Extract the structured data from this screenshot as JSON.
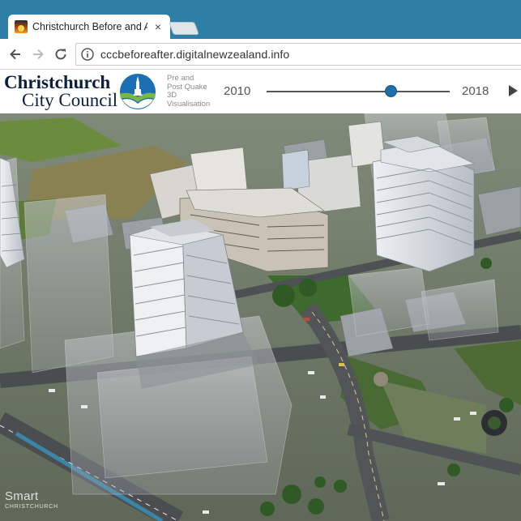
{
  "browser": {
    "tab": {
      "title": "Christchurch Before and Af",
      "close_glyph": "×"
    },
    "nav": {
      "back_icon": "arrow-left-icon",
      "forward_icon": "arrow-right-icon",
      "reload_icon": "reload-icon"
    },
    "address": {
      "url": "cccbeforeafter.digitalnewzealand.info",
      "info_icon": "info-icon"
    }
  },
  "app": {
    "logo": {
      "line1": "Christchurch",
      "line2": "City Council"
    },
    "tagline": [
      "Pre and",
      "Post Quake",
      "3D",
      "Visualisation"
    ],
    "timeline": {
      "start_year": "2010",
      "end_year": "2018",
      "position": 0.68,
      "accent": "#1f6fa8"
    },
    "play_icon": "play-icon"
  },
  "viewport": {
    "watermark": {
      "line1": "Smart",
      "line2": "CHRISTCHURCH"
    }
  }
}
